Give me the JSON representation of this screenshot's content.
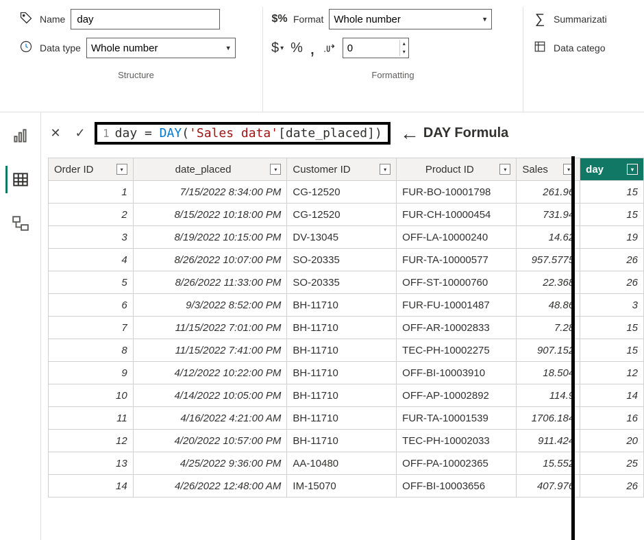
{
  "ribbon": {
    "structure": {
      "name_label": "Name",
      "name_value": "day",
      "datatype_label": "Data type",
      "datatype_value": "Whole number",
      "group_title": "Structure"
    },
    "formatting": {
      "format_label": "Format",
      "format_value": "Whole number",
      "decimals": "0",
      "group_title": "Formatting"
    },
    "props": {
      "summarization_label": "Summarizati",
      "category_label": "Data catego"
    }
  },
  "formula": {
    "line_no": "1",
    "lhs": "day",
    "eq": " = ",
    "fn": "DAY",
    "open": "(",
    "table_ref": "'Sales data'",
    "col_ref": "[date_placed]",
    "close": ")",
    "annotation": "DAY Formula"
  },
  "columns": [
    "Order ID",
    "date_placed",
    "Customer ID",
    "Product ID",
    "Sales",
    "day"
  ],
  "rows": [
    {
      "id": "1",
      "date": "7/15/2022 8:34:00 PM",
      "cust": "CG-12520",
      "prod": "FUR-BO-10001798",
      "sales": "261.96",
      "day": "15"
    },
    {
      "id": "2",
      "date": "8/15/2022 10:18:00 PM",
      "cust": "CG-12520",
      "prod": "FUR-CH-10000454",
      "sales": "731.94",
      "day": "15"
    },
    {
      "id": "3",
      "date": "8/19/2022 10:15:00 PM",
      "cust": "DV-13045",
      "prod": "OFF-LA-10000240",
      "sales": "14.62",
      "day": "19"
    },
    {
      "id": "4",
      "date": "8/26/2022 10:07:00 PM",
      "cust": "SO-20335",
      "prod": "FUR-TA-10000577",
      "sales": "957.5775",
      "day": "26"
    },
    {
      "id": "5",
      "date": "8/26/2022 11:33:00 PM",
      "cust": "SO-20335",
      "prod": "OFF-ST-10000760",
      "sales": "22.368",
      "day": "26"
    },
    {
      "id": "6",
      "date": "9/3/2022 8:52:00 PM",
      "cust": "BH-11710",
      "prod": "FUR-FU-10001487",
      "sales": "48.86",
      "day": "3"
    },
    {
      "id": "7",
      "date": "11/15/2022 7:01:00 PM",
      "cust": "BH-11710",
      "prod": "OFF-AR-10002833",
      "sales": "7.28",
      "day": "15"
    },
    {
      "id": "8",
      "date": "11/15/2022 7:41:00 PM",
      "cust": "BH-11710",
      "prod": "TEC-PH-10002275",
      "sales": "907.152",
      "day": "15"
    },
    {
      "id": "9",
      "date": "4/12/2022 10:22:00 PM",
      "cust": "BH-11710",
      "prod": "OFF-BI-10003910",
      "sales": "18.504",
      "day": "12"
    },
    {
      "id": "10",
      "date": "4/14/2022 10:05:00 PM",
      "cust": "BH-11710",
      "prod": "OFF-AP-10002892",
      "sales": "114.9",
      "day": "14"
    },
    {
      "id": "11",
      "date": "4/16/2022 4:21:00 AM",
      "cust": "BH-11710",
      "prod": "FUR-TA-10001539",
      "sales": "1706.184",
      "day": "16"
    },
    {
      "id": "12",
      "date": "4/20/2022 10:57:00 PM",
      "cust": "BH-11710",
      "prod": "TEC-PH-10002033",
      "sales": "911.424",
      "day": "20"
    },
    {
      "id": "13",
      "date": "4/25/2022 9:36:00 PM",
      "cust": "AA-10480",
      "prod": "OFF-PA-10002365",
      "sales": "15.552",
      "day": "25"
    },
    {
      "id": "14",
      "date": "4/26/2022 12:48:00 AM",
      "cust": "IM-15070",
      "prod": "OFF-BI-10003656",
      "sales": "407.976",
      "day": "26"
    }
  ]
}
